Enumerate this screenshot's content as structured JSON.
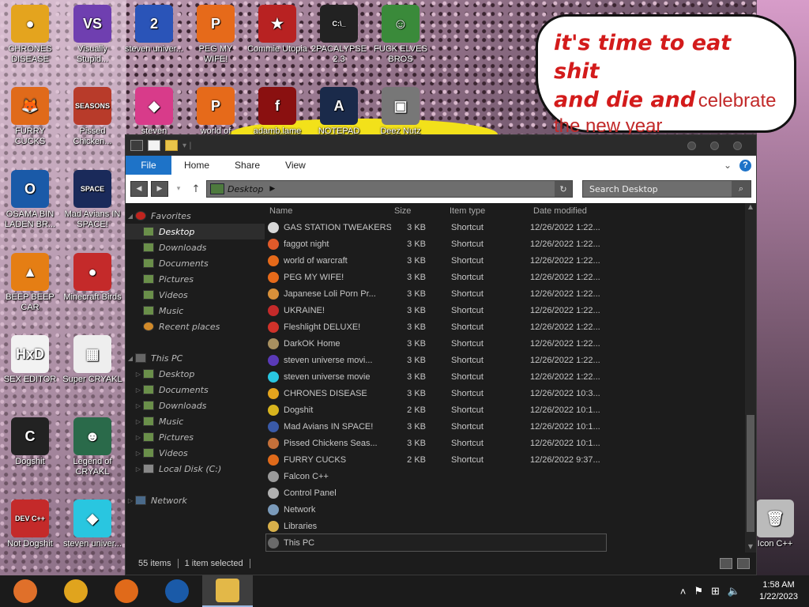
{
  "wallpaper": {
    "bubble": {
      "line1": "it's time to eat shit",
      "line2a": "and die and",
      "line2b": "celebrate",
      "line3": "the new year"
    }
  },
  "desktop_icons": [
    {
      "label": "CHRONES DISEASE",
      "color": "#e4a41e",
      "glyph": "●"
    },
    {
      "label": "Visually Stupid...",
      "color": "#6f3fb0",
      "glyph": "VS"
    },
    {
      "label": "steven univer...",
      "color": "#2a54b8",
      "glyph": "2"
    },
    {
      "label": "PEG MY WIFE!",
      "color": "#e66a1a",
      "glyph": "P"
    },
    {
      "label": "Commie Utopia",
      "color": "#b82222",
      "glyph": "★"
    },
    {
      "label": "2PACALYPSE 2.3",
      "color": "#222222",
      "glyph": "C:\\_"
    },
    {
      "label": "FUCK ELVES BROS",
      "color": "#3a8a3a",
      "glyph": "☺"
    },
    {
      "label": "FURRY CUCKS",
      "color": "#e06a1a",
      "glyph": "🦊"
    },
    {
      "label": "Pissed Chicken...",
      "color": "#b83b2a",
      "glyph": "SEASONS"
    },
    {
      "label": "steven",
      "color": "#d83b8a",
      "glyph": "◆"
    },
    {
      "label": "world of",
      "color": "#e66a1a",
      "glyph": "P"
    },
    {
      "label": "adamb.lame",
      "color": "#8a1010",
      "glyph": "f"
    },
    {
      "label": "NOTEPAD",
      "color": "#1a2a4a",
      "glyph": "A"
    },
    {
      "label": "Deez Nutz",
      "color": "#777777",
      "glyph": "▣"
    },
    {
      "label": "OSAMA BIN LADEN BR...",
      "color": "#1a5aa8",
      "glyph": "O"
    },
    {
      "label": "Mad Avians IN SPACE!",
      "color": "#1a2a5a",
      "glyph": "SPACE"
    },
    {
      "label": "BEEP BEEP CAR",
      "color": "#e57e14",
      "glyph": "▲"
    },
    {
      "label": "Minecraft Birds",
      "color": "#c42a2a",
      "glyph": "●"
    },
    {
      "label": "SEX EDITOR",
      "color": "#f2f2f2",
      "glyph": "HxD"
    },
    {
      "label": "Super CRYAKL",
      "color": "#eeeeee",
      "glyph": "▦"
    },
    {
      "label": "Dogshit",
      "color": "#222222",
      "glyph": "C"
    },
    {
      "label": "Legend of CRYAKL",
      "color": "#2a6a4a",
      "glyph": "☻"
    },
    {
      "label": "Not Dogshit",
      "color": "#c42a2a",
      "glyph": "DEV C++"
    },
    {
      "label": "steven univer...",
      "color": "#29c6e0",
      "glyph": "◆"
    },
    {
      "label": "Icon C++",
      "color": "#bbbbbb",
      "glyph": "🗑"
    }
  ],
  "explorer": {
    "ribbon": {
      "file": "File",
      "home": "Home",
      "share": "Share",
      "view": "View"
    },
    "address": "Desktop",
    "search_placeholder": "Search Desktop",
    "columns": {
      "name": "Name",
      "size": "Size",
      "type": "Item type",
      "date": "Date modified"
    },
    "nav": {
      "favorites": "Favorites",
      "fav_items": [
        "Desktop",
        "Downloads",
        "Documents",
        "Pictures",
        "Videos",
        "Music",
        "Recent places"
      ],
      "thispc": "This PC",
      "pc_items": [
        "Desktop",
        "Documents",
        "Downloads",
        "Music",
        "Pictures",
        "Videos",
        "Local Disk (C:)"
      ],
      "network": "Network"
    },
    "files": [
      {
        "name": "GAS STATION TWEAKERS",
        "size": "3 KB",
        "type": "Shortcut",
        "date": "12/26/2022 1:22...",
        "color": "#d8d8d8"
      },
      {
        "name": "faggot night",
        "size": "3 KB",
        "type": "Shortcut",
        "date": "12/26/2022 1:22...",
        "color": "#e05a2a"
      },
      {
        "name": "world of warcraft",
        "size": "3 KB",
        "type": "Shortcut",
        "date": "12/26/2022 1:22...",
        "color": "#e66a1a"
      },
      {
        "name": "PEG MY WIFE!",
        "size": "3 KB",
        "type": "Shortcut",
        "date": "12/26/2022 1:22...",
        "color": "#e66a1a"
      },
      {
        "name": "Japanese Loli Porn Pr...",
        "size": "3 KB",
        "type": "Shortcut",
        "date": "12/26/2022 1:22...",
        "color": "#d8903a"
      },
      {
        "name": "UKRAINE!",
        "size": "3 KB",
        "type": "Shortcut",
        "date": "12/26/2022 1:22...",
        "color": "#c42a2a"
      },
      {
        "name": "Fleshlight DELUXE!",
        "size": "3 KB",
        "type": "Shortcut",
        "date": "12/26/2022 1:22...",
        "color": "#d0322a"
      },
      {
        "name": "DarkOK Home",
        "size": "3 KB",
        "type": "Shortcut",
        "date": "12/26/2022 1:22...",
        "color": "#a89060"
      },
      {
        "name": "steven universe movi...",
        "size": "3 KB",
        "type": "Shortcut",
        "date": "12/26/2022 1:22...",
        "color": "#5a3ab8"
      },
      {
        "name": "steven universe movie",
        "size": "3 KB",
        "type": "Shortcut",
        "date": "12/26/2022 1:22...",
        "color": "#29c6e0"
      },
      {
        "name": "CHRONES DISEASE",
        "size": "3 KB",
        "type": "Shortcut",
        "date": "12/26/2022 10:3...",
        "color": "#e4a41e"
      },
      {
        "name": "Dogshit",
        "size": "2 KB",
        "type": "Shortcut",
        "date": "12/26/2022 10:1...",
        "color": "#d8b41e"
      },
      {
        "name": "Mad Avians IN SPACE!",
        "size": "3 KB",
        "type": "Shortcut",
        "date": "12/26/2022 10:1...",
        "color": "#3a5aa8"
      },
      {
        "name": "Pissed Chickens Seas...",
        "size": "3 KB",
        "type": "Shortcut",
        "date": "12/26/2022 10:1...",
        "color": "#c4703a"
      },
      {
        "name": "FURRY CUCKS",
        "size": "2 KB",
        "type": "Shortcut",
        "date": "12/26/2022 9:37...",
        "color": "#e06a1a"
      },
      {
        "name": "Falcon C++",
        "size": "",
        "type": "",
        "date": "",
        "color": "#9a9a9a"
      },
      {
        "name": "Control Panel",
        "size": "",
        "type": "",
        "date": "",
        "color": "#b0b0b0"
      },
      {
        "name": "Network",
        "size": "",
        "type": "",
        "date": "",
        "color": "#7a9aba"
      },
      {
        "name": "Libraries",
        "size": "",
        "type": "",
        "date": "",
        "color": "#d8b04a"
      },
      {
        "name": "This PC",
        "size": "",
        "type": "",
        "date": "",
        "color": "#6a6a6a"
      }
    ],
    "status": {
      "count": "55 items",
      "selected": "1 item selected"
    }
  },
  "taskbar": {
    "apps": [
      {
        "name": "chrome-old",
        "color": "#e0702a"
      },
      {
        "name": "chrome",
        "color": "#e0a41e"
      },
      {
        "name": "firefox",
        "color": "#e06a1a"
      },
      {
        "name": "obama",
        "color": "#1a5aa8"
      },
      {
        "name": "explorer",
        "color": "#e3b848"
      }
    ],
    "time": "1:58 AM",
    "date": "1/22/2023"
  }
}
